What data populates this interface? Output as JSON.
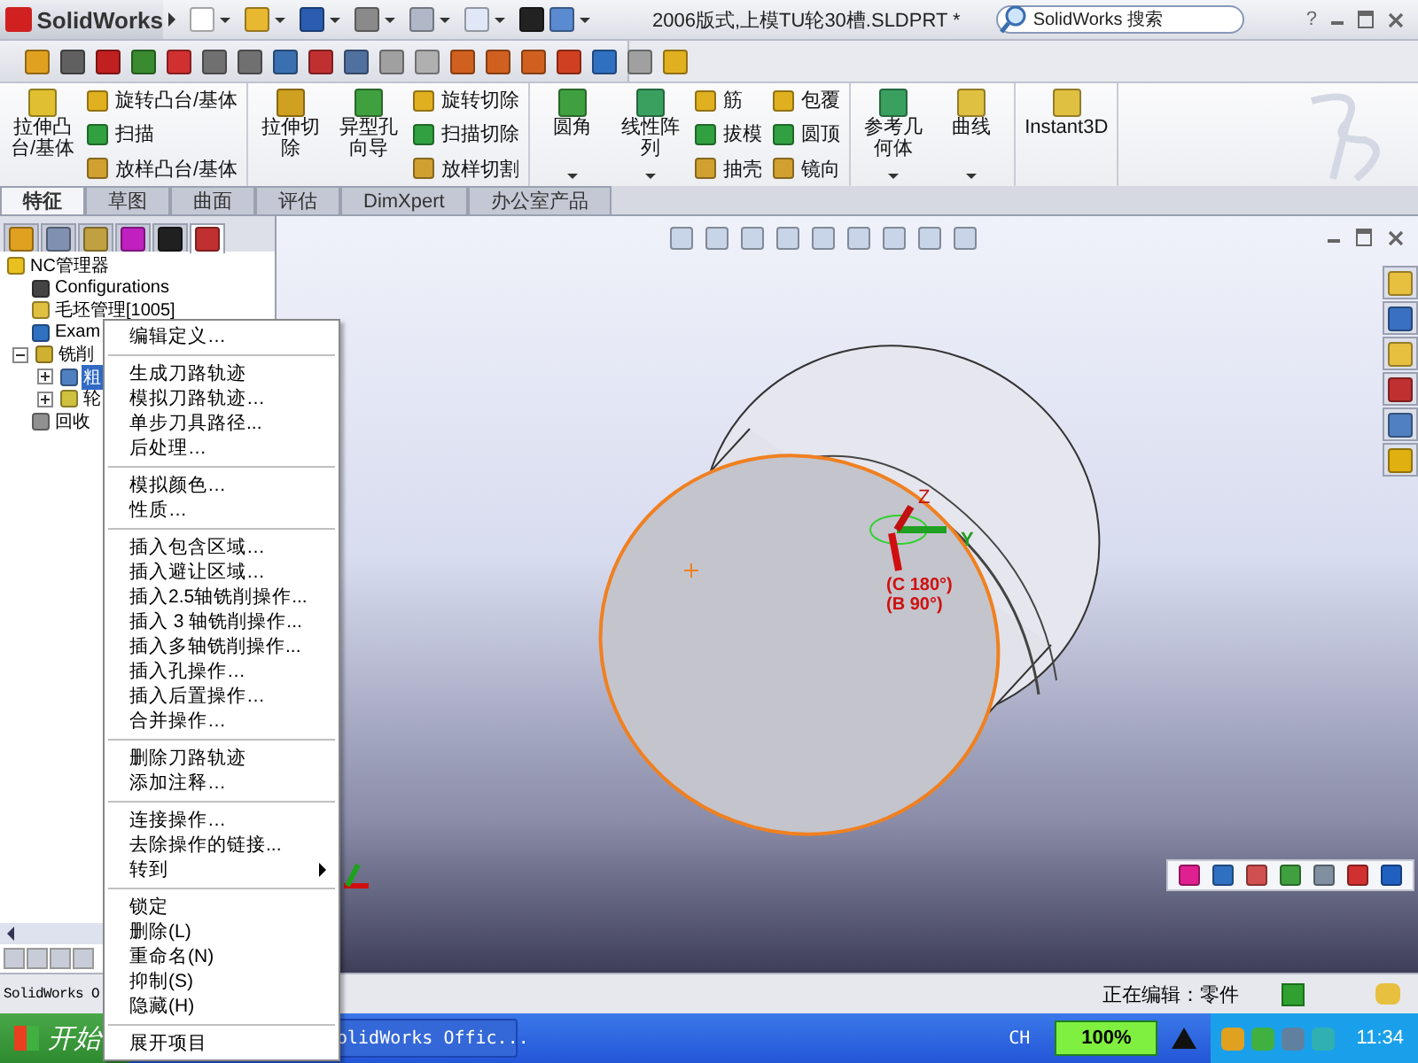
{
  "app": {
    "logo": "SolidWorks"
  },
  "window": {
    "title": "2006版式,上模TU轮30槽.SLDPRT *",
    "help": "?"
  },
  "search": {
    "placeholder": "SolidWorks 搜索"
  },
  "command_manager": {
    "groups": [
      {
        "large": [
          {
            "label": "拉伸凸台/基体",
            "dropdown": false
          }
        ],
        "small_columns": [
          [
            {
              "label": "旋转凸台/基体"
            },
            {
              "label": "扫描"
            },
            {
              "label": "放样凸台/基体"
            }
          ]
        ]
      },
      {
        "large": [
          {
            "label": "拉伸切除",
            "dropdown": false
          },
          {
            "label": "异型孔向导",
            "dropdown": false
          }
        ],
        "small_columns": [
          [
            {
              "label": "旋转切除"
            },
            {
              "label": "扫描切除"
            },
            {
              "label": "放样切割"
            }
          ]
        ]
      },
      {
        "large": [
          {
            "label": "圆角",
            "dropdown": true
          },
          {
            "label": "线性阵列",
            "dropdown": true
          }
        ],
        "small_columns": [
          [
            {
              "label": "筋"
            },
            {
              "label": "拔模"
            },
            {
              "label": "抽壳"
            }
          ],
          [
            {
              "label": "包覆"
            },
            {
              "label": "圆顶"
            },
            {
              "label": "镜向"
            }
          ]
        ]
      },
      {
        "large": [
          {
            "label": "参考几何体",
            "dropdown": true
          },
          {
            "label": "曲线",
            "dropdown": true
          }
        ]
      },
      {
        "large": [
          {
            "label": "Instant3D",
            "dropdown": false
          }
        ]
      }
    ]
  },
  "tabs": [
    {
      "label": "特征",
      "selected": true
    },
    {
      "label": "草图",
      "selected": false
    },
    {
      "label": "曲面",
      "selected": false
    },
    {
      "label": "评估",
      "selected": false
    },
    {
      "label": "DimXpert",
      "selected": false
    },
    {
      "label": "办公室产品",
      "selected": false
    }
  ],
  "panel_tabs": [
    {
      "selected": false
    },
    {
      "selected": false
    },
    {
      "selected": false
    },
    {
      "selected": false
    },
    {
      "selected": false
    },
    {
      "selected": true
    }
  ],
  "feature_tree": {
    "items": [
      {
        "label": "NC管理器",
        "selected": false,
        "children": [
          {
            "label": "Configurations",
            "selected": false
          },
          {
            "label": "毛坯管理[1005]",
            "selected": false
          },
          {
            "label": "Exam",
            "selected": false
          },
          {
            "label": "铣削",
            "selected": false,
            "expanded": true,
            "children": [
              {
                "label": "粗",
                "selected": true,
                "expanded": false
              },
              {
                "label": "轮",
                "selected": false,
                "expanded": false
              }
            ]
          },
          {
            "label": "回收",
            "selected": false
          }
        ]
      }
    ]
  },
  "context_menu": {
    "sections": [
      [
        {
          "label": "编辑定义…",
          "submenu": false
        }
      ],
      [
        {
          "label": "生成刀路轨迹",
          "submenu": false
        },
        {
          "label": "模拟刀路轨迹…",
          "submenu": false
        },
        {
          "label": "单步刀具路径...",
          "submenu": false
        },
        {
          "label": "后处理…",
          "submenu": false
        }
      ],
      [
        {
          "label": "模拟颜色…",
          "submenu": false
        },
        {
          "label": "性质…",
          "submenu": false
        }
      ],
      [
        {
          "label": "插入包含区域…",
          "submenu": false
        },
        {
          "label": "插入避让区域…",
          "submenu": false
        },
        {
          "label": "插入2.5轴铣削操作...",
          "submenu": false
        },
        {
          "label": "插入 3 轴铣削操作...",
          "submenu": false
        },
        {
          "label": "插入多轴铣削操作...",
          "submenu": false
        },
        {
          "label": "插入孔操作…",
          "submenu": false
        },
        {
          "label": "插入后置操作…",
          "submenu": false
        },
        {
          "label": "合并操作…",
          "submenu": false
        }
      ],
      [
        {
          "label": "删除刀路轨迹",
          "submenu": false
        },
        {
          "label": "添加注释…",
          "submenu": false
        }
      ],
      [
        {
          "label": "连接操作…",
          "submenu": false
        },
        {
          "label": "去除操作的链接...",
          "submenu": false
        },
        {
          "label": "转到",
          "submenu": true
        }
      ],
      [
        {
          "label": "锁定",
          "submenu": false
        },
        {
          "label": "删除(L)",
          "submenu": false
        },
        {
          "label": "重命名(N)",
          "submenu": false
        },
        {
          "label": "抑制(S)",
          "submenu": false
        },
        {
          "label": "隐藏(H)",
          "submenu": false
        }
      ],
      [
        {
          "label": "展开项目",
          "submenu": false
        }
      ]
    ]
  },
  "viewport": {
    "triad_labels": [
      "Z",
      "Y"
    ],
    "angles": [
      "(C 180°)",
      "(B 90°)"
    ]
  },
  "status_bar": {
    "left_text": "SolidWorks O",
    "editing": "正在编辑：零件"
  },
  "taskbar": {
    "start": "开始",
    "task": "olidWorks Offic...",
    "language": "CH",
    "battery": "100%",
    "time": "11:34"
  }
}
